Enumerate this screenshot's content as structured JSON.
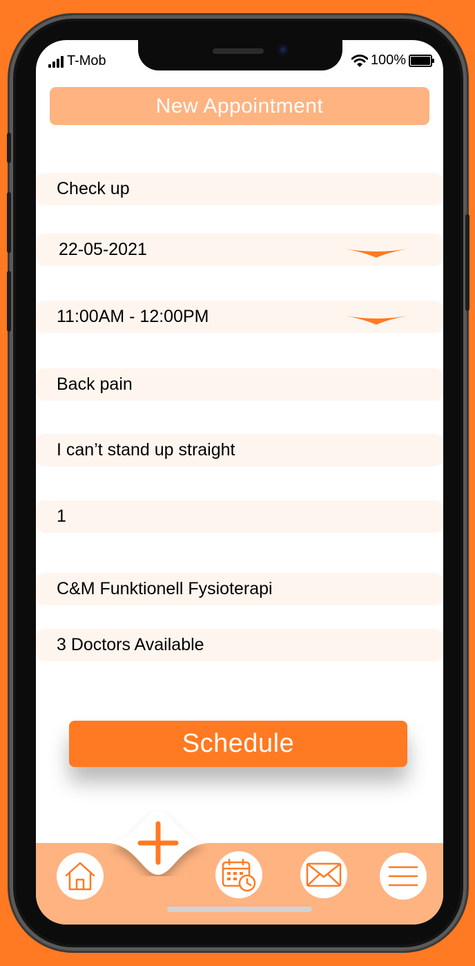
{
  "status_bar": {
    "carrier": "T-Mob",
    "battery_percent": "100%"
  },
  "header": {
    "title": "New Appointment"
  },
  "form": {
    "appointment_type": "Check up",
    "date": "22-05-2021",
    "time_slot": "11:00AM - 12:00PM",
    "reason": "Back pain",
    "description": "I can’t stand up straight",
    "count": "1",
    "clinic": "C&M Funktionell Fysioterapi",
    "doctors": "3 Doctors Available"
  },
  "actions": {
    "schedule_label": "Schedule"
  },
  "bottom_nav": {
    "items": [
      {
        "icon": "home-icon"
      },
      {
        "icon": "add-icon"
      },
      {
        "icon": "calendar-clock-icon"
      },
      {
        "icon": "mail-icon"
      },
      {
        "icon": "menu-icon"
      }
    ]
  },
  "colors": {
    "accent": "#FF7A22",
    "accent_light": "#FEB381",
    "field_bg": "#FFF5EF"
  }
}
